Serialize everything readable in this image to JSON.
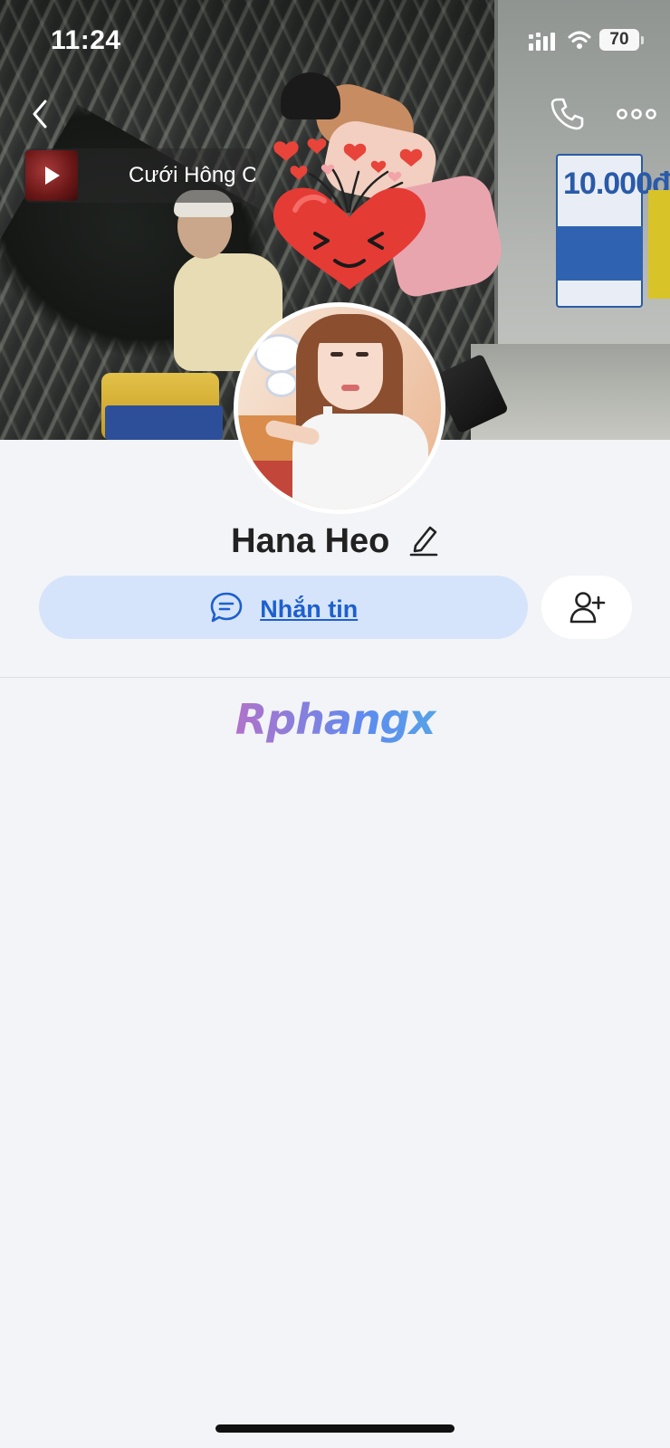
{
  "status_bar": {
    "time": "11:24",
    "battery_level": "70",
    "signal_icon": "cellular-signal-icon",
    "wifi_icon": "wifi-icon"
  },
  "nav": {
    "back_icon": "chevron-left-icon",
    "call_icon": "phone-icon",
    "more_icon": "more-horizontal-icon"
  },
  "music": {
    "title": "Cưới Hông C",
    "play_icon": "play-icon"
  },
  "profile": {
    "name": "Hana Heo",
    "edit_icon": "pencil-icon"
  },
  "actions": {
    "message_label": "Nhắn tin",
    "message_icon": "chat-bubble-icon",
    "add_friend_icon": "add-user-icon"
  },
  "cover": {
    "sign_text": "10.000đ"
  },
  "watermark": {
    "text": "Rphangx"
  },
  "colors": {
    "page_bg": "#f3f4f7",
    "message_button_bg": "#d5e4fb",
    "accent_blue": "#1d5fcd",
    "name_color": "#222222"
  }
}
